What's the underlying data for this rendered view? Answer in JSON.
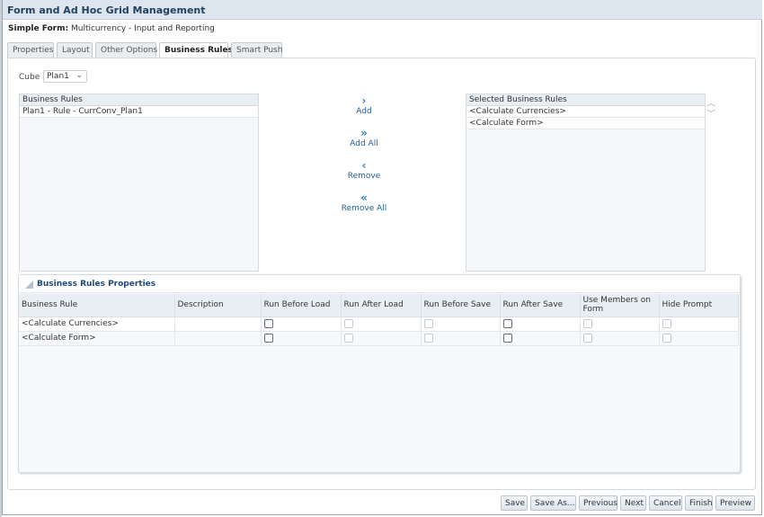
{
  "window": {
    "title": "Form and Ad Hoc Grid Management"
  },
  "form": {
    "type_label": "Simple Form:",
    "name": "Multicurrency - Input and Reporting"
  },
  "tabs": [
    {
      "label": "Properties",
      "active": false
    },
    {
      "label": "Layout",
      "active": false
    },
    {
      "label": "Other Options",
      "active": false
    },
    {
      "label": "Business Rules",
      "active": true
    },
    {
      "label": "Smart Push",
      "active": false
    }
  ],
  "cube": {
    "label": "Cube",
    "value": "Plan1"
  },
  "available_rules": {
    "header": "Business Rules",
    "items": [
      "Plan1 - Rule - CurrConv_Plan1"
    ]
  },
  "movers": {
    "add": "Add",
    "add_all": "Add All",
    "remove": "Remove",
    "remove_all": "Remove All"
  },
  "selected_rules": {
    "header": "Selected Business Rules",
    "items": [
      "<Calculate Currencies>",
      "<Calculate Form>"
    ]
  },
  "properties": {
    "title": "Business Rules Properties",
    "columns": [
      "Business Rule",
      "Description",
      "Run Before Load",
      "Run After Load",
      "Run Before Save",
      "Run After Save",
      "Use Members on Form",
      "Hide Prompt"
    ],
    "rows": [
      {
        "rule": "<Calculate Currencies>",
        "description": "",
        "run_before_load": false,
        "run_after_load": false,
        "run_before_save": false,
        "run_after_save": false,
        "use_members_on_form": false,
        "hide_prompt": false
      },
      {
        "rule": "<Calculate Form>",
        "description": "",
        "run_before_load": false,
        "run_after_load": false,
        "run_before_save": false,
        "run_after_save": false,
        "use_members_on_form": false,
        "hide_prompt": false
      }
    ]
  },
  "buttons": {
    "save": "Save",
    "save_as": "Save As...",
    "previous": "Previous",
    "next": "Next",
    "cancel": "Cancel",
    "finish": "Finish",
    "preview": "Preview"
  }
}
